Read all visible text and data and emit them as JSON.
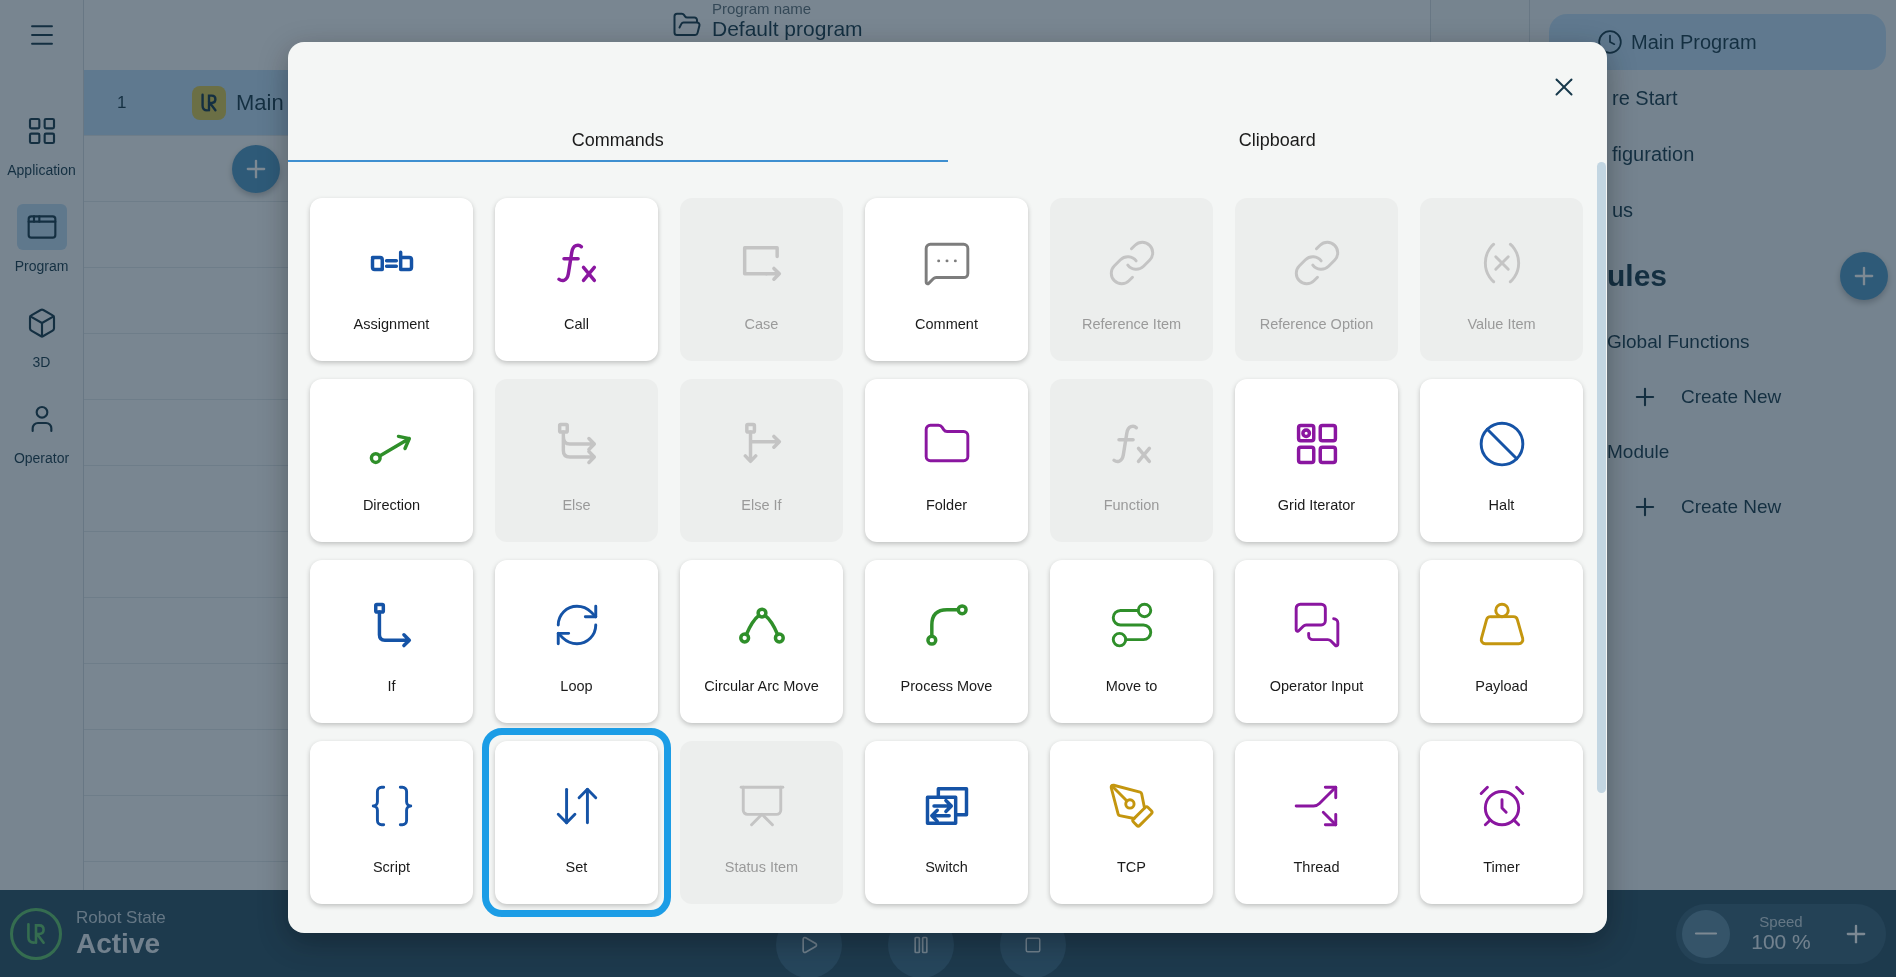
{
  "sidebar": {
    "items": [
      {
        "label": "Application",
        "selected": false
      },
      {
        "label": "Program",
        "selected": true
      },
      {
        "label": "3D",
        "selected": false
      },
      {
        "label": "Operator",
        "selected": false
      }
    ]
  },
  "header": {
    "caption": "Program name",
    "program_name": "Default program"
  },
  "program_tree": {
    "rows": [
      {
        "number": "1",
        "label": "Main",
        "selected": true
      }
    ]
  },
  "right_panel": {
    "main_item": "Main Program",
    "items": [
      "re Start",
      "figuration",
      "us"
    ],
    "section_title": "ules",
    "groups": [
      {
        "label": "Global Functions",
        "action": "Create New"
      },
      {
        "label": "Module",
        "action": "Create New"
      }
    ]
  },
  "status_bar": {
    "caption": "Robot State",
    "state": "Active",
    "speed_caption": "Speed",
    "speed": "100 %"
  },
  "dialog": {
    "tabs": [
      {
        "label": "Commands",
        "selected": true
      },
      {
        "label": "Clipboard",
        "selected": false
      }
    ],
    "commands": [
      {
        "label": "Assignment",
        "disabled": false,
        "selected": false,
        "color": "#1553a6"
      },
      {
        "label": "Call",
        "disabled": false,
        "selected": false,
        "color": "#8a16a0"
      },
      {
        "label": "Case",
        "disabled": true,
        "selected": false
      },
      {
        "label": "Comment",
        "disabled": false,
        "selected": false,
        "color": "#7d7d7d"
      },
      {
        "label": "Reference Item",
        "disabled": true,
        "selected": false
      },
      {
        "label": "Reference Option",
        "disabled": true,
        "selected": false
      },
      {
        "label": "Value Item",
        "disabled": true,
        "selected": false
      },
      {
        "label": "Direction",
        "disabled": false,
        "selected": false,
        "color": "#2f8f2a"
      },
      {
        "label": "Else",
        "disabled": true,
        "selected": false
      },
      {
        "label": "Else If",
        "disabled": true,
        "selected": false
      },
      {
        "label": "Folder",
        "disabled": false,
        "selected": false,
        "color": "#8a16a0"
      },
      {
        "label": "Function",
        "disabled": true,
        "selected": false
      },
      {
        "label": "Grid Iterator",
        "disabled": false,
        "selected": false,
        "color": "#8a16a0"
      },
      {
        "label": "Halt",
        "disabled": false,
        "selected": false,
        "color": "#1553a6"
      },
      {
        "label": "If",
        "disabled": false,
        "selected": false,
        "color": "#1553a6"
      },
      {
        "label": "Loop",
        "disabled": false,
        "selected": false,
        "color": "#1553a6"
      },
      {
        "label": "Circular Arc Move",
        "disabled": false,
        "selected": false,
        "color": "#2f8f2a"
      },
      {
        "label": "Process Move",
        "disabled": false,
        "selected": false,
        "color": "#2f8f2a"
      },
      {
        "label": "Move to",
        "disabled": false,
        "selected": false,
        "color": "#2f8f2a"
      },
      {
        "label": "Operator Input",
        "disabled": false,
        "selected": false,
        "color": "#8a16a0"
      },
      {
        "label": "Payload",
        "disabled": false,
        "selected": false,
        "color": "#c4960f"
      },
      {
        "label": "Script",
        "disabled": false,
        "selected": false,
        "color": "#1553a6"
      },
      {
        "label": "Set",
        "disabled": false,
        "selected": true,
        "color": "#1553a6"
      },
      {
        "label": "Status Item",
        "disabled": true,
        "selected": false
      },
      {
        "label": "Switch",
        "disabled": false,
        "selected": false,
        "color": "#1553a6"
      },
      {
        "label": "TCP",
        "disabled": false,
        "selected": false,
        "color": "#c4960f"
      },
      {
        "label": "Thread",
        "disabled": false,
        "selected": false,
        "color": "#8a16a0"
      },
      {
        "label": "Timer",
        "disabled": false,
        "selected": false,
        "color": "#8a16a0"
      }
    ]
  }
}
